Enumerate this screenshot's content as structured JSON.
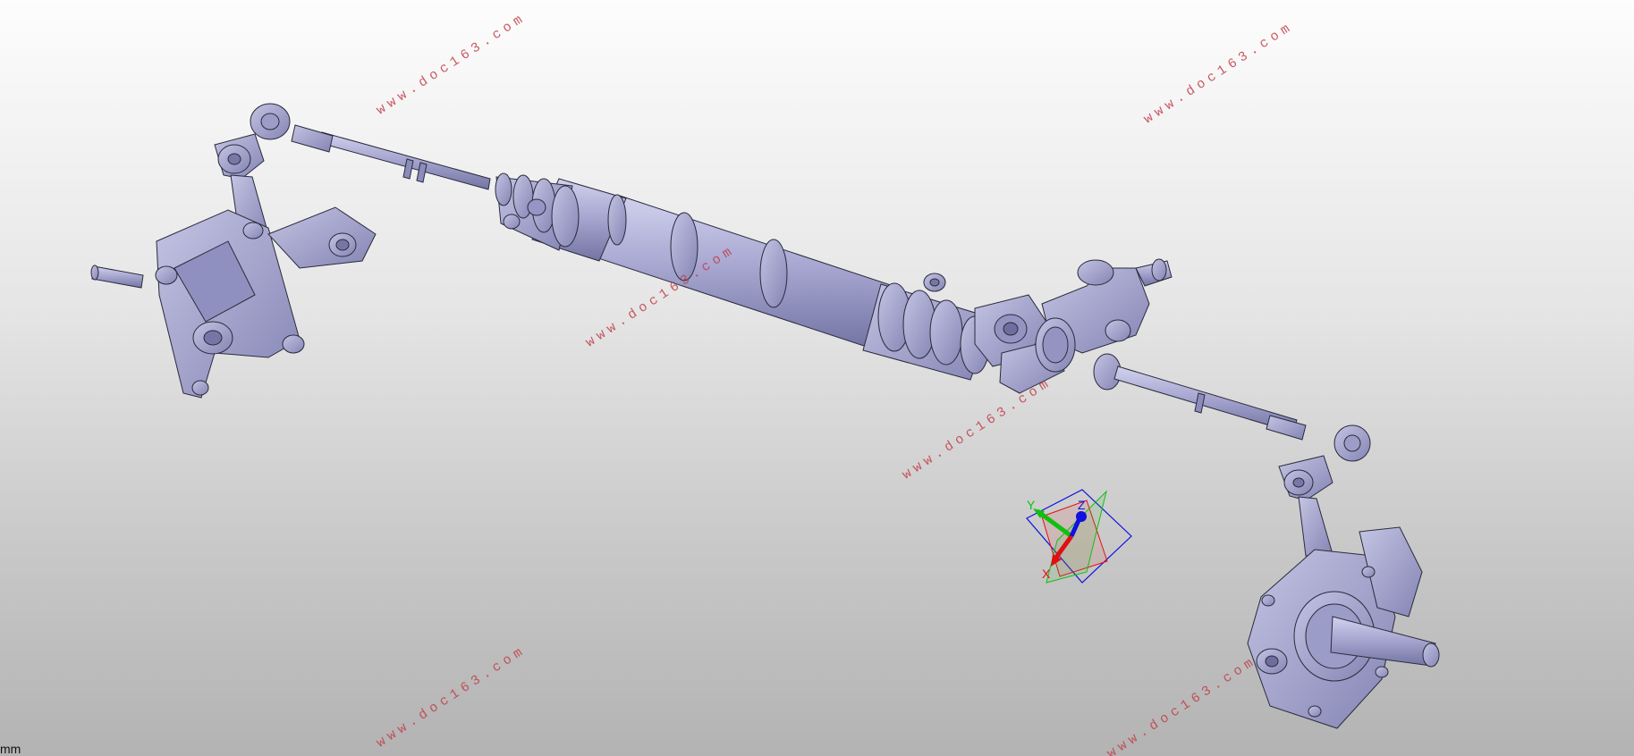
{
  "viewport": {
    "units_label": "mm",
    "watermark_text": "www.doc163.com",
    "model_color": "#a9a9cf",
    "model_edge_color": "#2a2a3c",
    "watermark_color": "#c0404a"
  },
  "compass": {
    "x_label": "X",
    "y_label": "Y",
    "z_label": "Z",
    "x_color": "#e01010",
    "y_color": "#10c010",
    "z_color": "#1010e0"
  }
}
